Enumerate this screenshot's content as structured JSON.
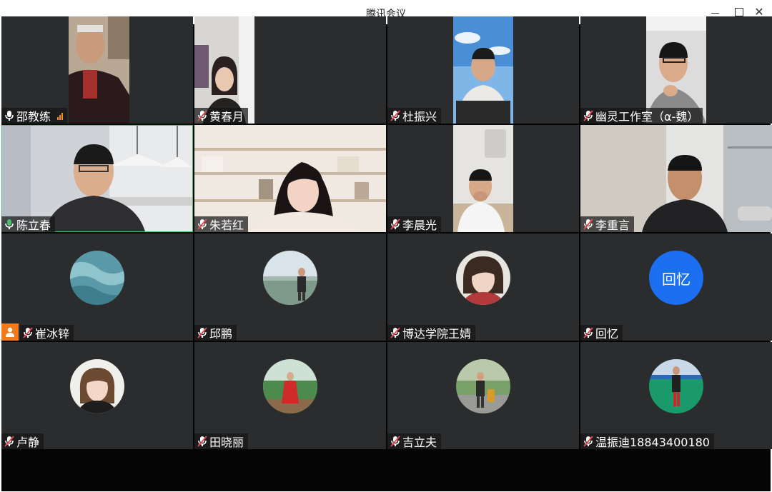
{
  "window": {
    "title": "腾讯会议",
    "minimize": "–",
    "maximize": "□",
    "close": "✕"
  },
  "participants": [
    {
      "name": "邵教练",
      "mic": "on",
      "signal": true
    },
    {
      "name": "黄春月",
      "mic": "muted"
    },
    {
      "name": "杜振兴",
      "mic": "muted"
    },
    {
      "name": "幽灵工作室（α-魏）",
      "mic": "muted"
    },
    {
      "name": "陈立春",
      "mic": "speaking"
    },
    {
      "name": "朱若红",
      "mic": "muted"
    },
    {
      "name": "李晨光",
      "mic": "muted"
    },
    {
      "name": "李重言",
      "mic": "muted"
    },
    {
      "name": "崔冰锌",
      "mic": "muted",
      "host": true
    },
    {
      "name": "邱鹏",
      "mic": "muted"
    },
    {
      "name": "博达学院王婧",
      "mic": "muted"
    },
    {
      "name": "回忆",
      "mic": "muted",
      "avatar_text": "回忆"
    },
    {
      "name": "卢静",
      "mic": "muted"
    },
    {
      "name": "田晓丽",
      "mic": "muted"
    },
    {
      "name": "吉立夫",
      "mic": "muted"
    },
    {
      "name": "温振迪18843400180",
      "mic": "muted"
    }
  ],
  "colors": {
    "tile_bg": "#2b2c2e",
    "speaking_border": "#4cbd6e",
    "muted_icon": "#e5484d",
    "host_badge": "#f07a1c",
    "text_avatar": "#1d6ff2"
  }
}
